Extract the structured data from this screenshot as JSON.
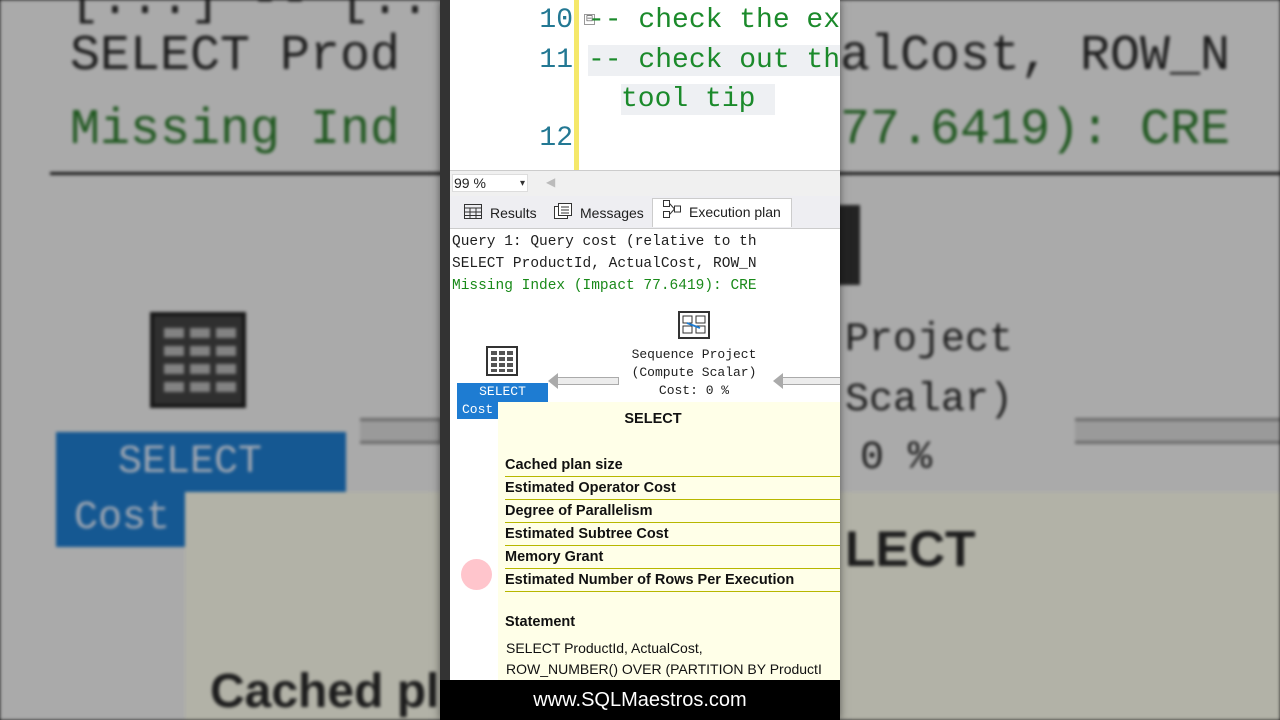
{
  "editor": {
    "lines": [
      {
        "number": "10",
        "text": "-- check the ex"
      },
      {
        "number": "11",
        "text": "-- check out th",
        "wrap": "tool tip"
      },
      {
        "number": "12",
        "text": ""
      }
    ],
    "collapse_glyph": "⊟"
  },
  "zoom": {
    "value": "99 %"
  },
  "tabs": [
    {
      "label": "Results",
      "icon": "grid-icon"
    },
    {
      "label": "Messages",
      "icon": "messages-icon"
    },
    {
      "label": "Execution plan",
      "icon": "execution-plan-icon",
      "active": true
    }
  ],
  "query": {
    "line1": "Query 1: Query cost (relative to th",
    "line2": "SELECT ProductId, ActualCost, ROW_N",
    "line3": "Missing Index (Impact 77.6419): CRE"
  },
  "plan": {
    "select_op": {
      "label": "SELECT",
      "cost_label": "Cost"
    },
    "sequence_op": {
      "line1": "Sequence Project",
      "line2": "(Compute Scalar)",
      "line3": "Cost: 0 %"
    }
  },
  "tooltip": {
    "title": "SELECT",
    "rows": [
      "Cached plan size",
      "Estimated Operator Cost",
      "Degree of Parallelism",
      "Estimated Subtree Cost",
      "Memory Grant",
      "Estimated Number of Rows Per Execution"
    ],
    "statement_label": "Statement",
    "statement_line1": "SELECT ProductId, ActualCost,",
    "statement_line2": "ROW_NUMBER() OVER (PARTITION BY ProductI"
  },
  "background": {
    "line1": "[...] -- [...]",
    "line2": "SELECT Prod",
    "line2b": "alCost, ROW_N",
    "line3": "Missing Ind",
    "line3b": "77.6419): CRE",
    "proj1": "Project",
    "proj2": "Scalar)",
    "proj3": "0 %",
    "select": "SELECT",
    "cost": "Cost",
    "lect": "LECT",
    "cached": "Cached pl"
  },
  "footer": {
    "url": "www.SQLMaestros.com"
  }
}
